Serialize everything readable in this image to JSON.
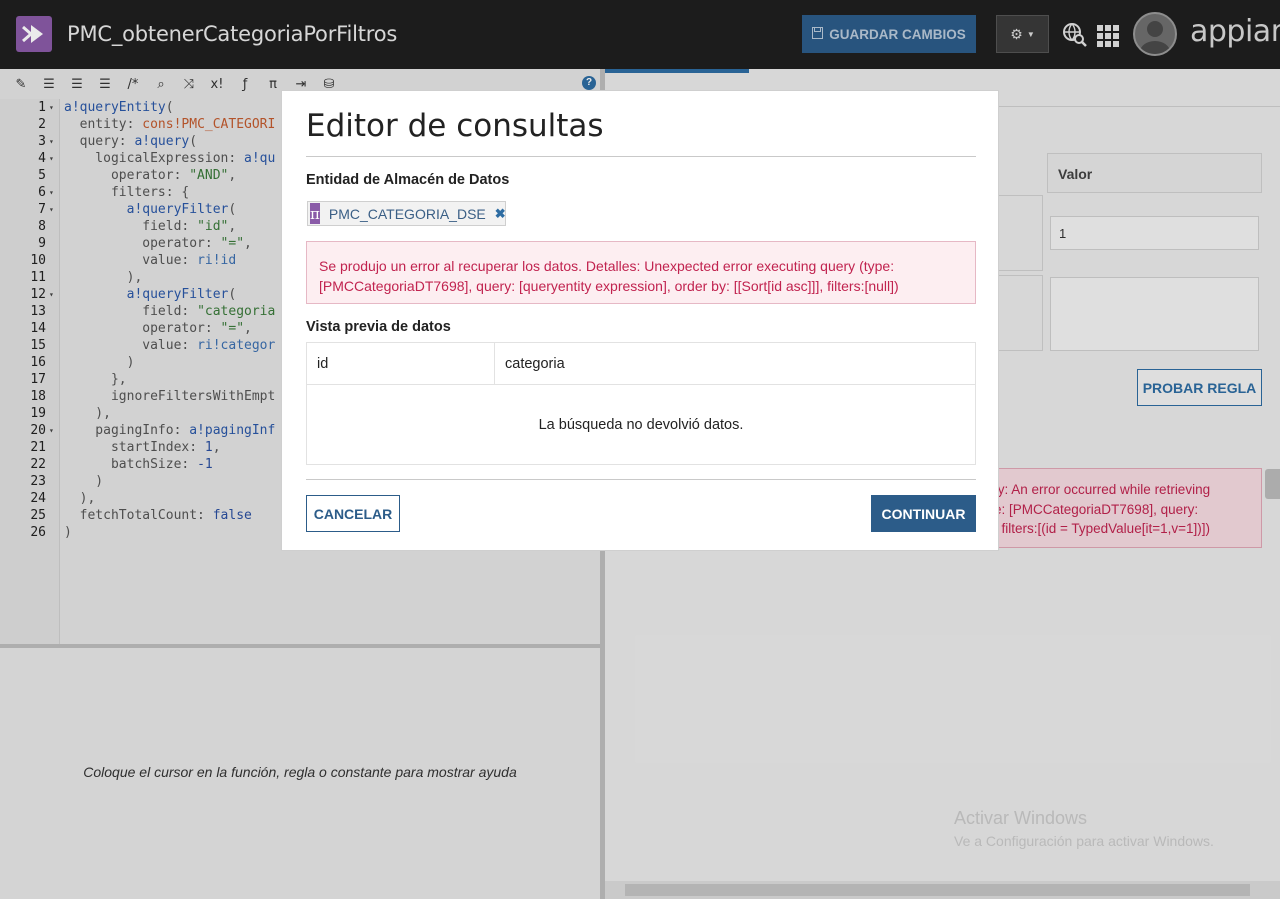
{
  "header": {
    "title": "PMC_obtenerCategoriaPorFiltros",
    "save_label": "GUARDAR CAMBIOS",
    "brand": "appian"
  },
  "toolbar": {
    "icons": [
      "wand-icon",
      "outdent-icon",
      "indent-icon",
      "format-icon",
      "comment-icon",
      "search-icon",
      "shuffle-icon",
      "expression-icon",
      "function-icon",
      "constant-icon",
      "export-icon",
      "database-icon",
      "help-icon"
    ]
  },
  "code": {
    "lines": [
      {
        "n": "1",
        "fold": "▾",
        "parts": [
          [
            "kw",
            "a!queryEntity"
          ],
          [
            "",
            "("
          ]
        ]
      },
      {
        "n": "2",
        "fold": "",
        "parts": [
          [
            "",
            "  entity: "
          ],
          [
            "cons",
            "cons!PMC_CATEGORI"
          ]
        ]
      },
      {
        "n": "3",
        "fold": "▾",
        "parts": [
          [
            "",
            "  query: "
          ],
          [
            "kw",
            "a!query"
          ],
          [
            "",
            "("
          ]
        ]
      },
      {
        "n": "4",
        "fold": "▾",
        "parts": [
          [
            "",
            "    logicalExpression: "
          ],
          [
            "kw",
            "a!qu"
          ]
        ]
      },
      {
        "n": "5",
        "fold": "",
        "parts": [
          [
            "",
            "      operator: "
          ],
          [
            "str",
            "\"AND\""
          ],
          [
            "",
            ","
          ]
        ]
      },
      {
        "n": "6",
        "fold": "▾",
        "parts": [
          [
            "",
            "      filters: {"
          ]
        ]
      },
      {
        "n": "7",
        "fold": "▾",
        "parts": [
          [
            "",
            "        "
          ],
          [
            "kw",
            "a!queryFilter"
          ],
          [
            "",
            "("
          ]
        ]
      },
      {
        "n": "8",
        "fold": "",
        "parts": [
          [
            "",
            "          field: "
          ],
          [
            "str",
            "\"id\""
          ],
          [
            "",
            ","
          ]
        ]
      },
      {
        "n": "9",
        "fold": "",
        "parts": [
          [
            "",
            "          operator: "
          ],
          [
            "str",
            "\"=\""
          ],
          [
            "",
            ","
          ]
        ]
      },
      {
        "n": "10",
        "fold": "",
        "parts": [
          [
            "",
            "          value: "
          ],
          [
            "ri",
            "ri!id"
          ]
        ]
      },
      {
        "n": "11",
        "fold": "",
        "parts": [
          [
            "",
            "        ),"
          ]
        ]
      },
      {
        "n": "12",
        "fold": "▾",
        "parts": [
          [
            "",
            "        "
          ],
          [
            "kw",
            "a!queryFilter"
          ],
          [
            "",
            "("
          ]
        ]
      },
      {
        "n": "13",
        "fold": "",
        "parts": [
          [
            "",
            "          field: "
          ],
          [
            "str",
            "\"categoria"
          ]
        ]
      },
      {
        "n": "14",
        "fold": "",
        "parts": [
          [
            "",
            "          operator: "
          ],
          [
            "str",
            "\"=\""
          ],
          [
            "",
            ","
          ]
        ]
      },
      {
        "n": "15",
        "fold": "",
        "parts": [
          [
            "",
            "          value: "
          ],
          [
            "ri",
            "ri!categor"
          ]
        ]
      },
      {
        "n": "16",
        "fold": "",
        "parts": [
          [
            "",
            "        )"
          ]
        ]
      },
      {
        "n": "17",
        "fold": "",
        "parts": [
          [
            "",
            "      },"
          ]
        ]
      },
      {
        "n": "18",
        "fold": "",
        "parts": [
          [
            "",
            "      ignoreFiltersWithEmpt"
          ]
        ]
      },
      {
        "n": "19",
        "fold": "",
        "parts": [
          [
            "",
            "    ),"
          ]
        ]
      },
      {
        "n": "20",
        "fold": "▾",
        "parts": [
          [
            "",
            "    pagingInfo: "
          ],
          [
            "kw",
            "a!pagingInf"
          ]
        ]
      },
      {
        "n": "21",
        "fold": "",
        "parts": [
          [
            "",
            "      startIndex: "
          ],
          [
            "lit",
            "1"
          ],
          [
            "",
            ","
          ]
        ]
      },
      {
        "n": "22",
        "fold": "",
        "parts": [
          [
            "",
            "      batchSize: "
          ],
          [
            "lit",
            "-1"
          ]
        ]
      },
      {
        "n": "23",
        "fold": "",
        "parts": [
          [
            "",
            "    )"
          ]
        ]
      },
      {
        "n": "24",
        "fold": "",
        "parts": [
          [
            "",
            "  ),"
          ]
        ]
      },
      {
        "n": "25",
        "fold": "",
        "parts": [
          [
            "",
            "  fetchTotalCount: "
          ],
          [
            "lit",
            "false"
          ]
        ]
      },
      {
        "n": "26",
        "fold": "",
        "parts": [
          [
            "",
            ")"
          ]
        ]
      }
    ]
  },
  "help_panel": {
    "text": "Coloque el cursor en la función, regla o constante para mostrar ayuda"
  },
  "right_panel": {
    "value_header": "Valor",
    "input_value": "1",
    "test_button": "PROBAR REGLA",
    "error_lines": [
      "ty: An error occurred while retrieving",
      "e: [PMCCategoriaDT7698], query:",
      ", filters:[(id = TypedValue[it=1,v=1])])"
    ],
    "watermark_title": "Activar Windows",
    "watermark_sub": "Ve a Configuración para activar Windows."
  },
  "modal": {
    "title": "Editor de consultas",
    "entity_label": "Entidad de Almacén de Datos",
    "entity_icon": "π",
    "entity_name": "PMC_CATEGORIA_DSE",
    "error_line1": "Se produjo un error al recuperar los datos. Detalles: Unexpected error executing query (type:",
    "error_line2": "[PMCCategoriaDT7698], query: [queryentity expression], order by: [[Sort[id asc]]], filters:[null])",
    "preview_label": "Vista previa de datos",
    "columns": [
      "id",
      "categoria"
    ],
    "no_data": "La búsqueda no devolvió datos.",
    "cancel_label": "CANCELAR",
    "continue_label": "CONTINUAR"
  },
  "colors": {
    "header_bg": "#1f1f1f",
    "accent": "#2c5c89",
    "error": "#c1234f",
    "purple": "#8a5ba8"
  }
}
